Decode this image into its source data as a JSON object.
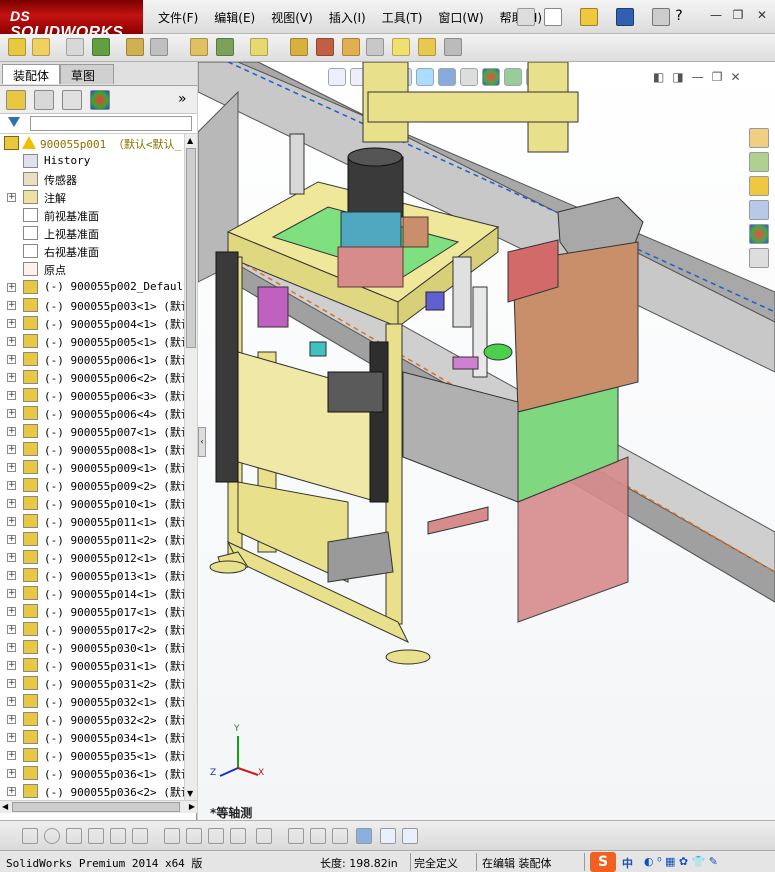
{
  "app": {
    "logo_prefix": "DS",
    "logo": "SOLIDWORKS"
  },
  "menu": [
    "文件(F)",
    "编辑(E)",
    "视图(V)",
    "插入(I)",
    "工具(T)",
    "窗口(W)",
    "帮助(H)"
  ],
  "window_buttons": {
    "minimize": "—",
    "restore": "❐",
    "close": "✕"
  },
  "panel_tabs": {
    "assembly": "装配体",
    "sketch": "草图"
  },
  "panel_collapse": "»",
  "tree": {
    "root": "900055p001 （默认<默认_",
    "items": [
      {
        "label": "History",
        "icon": "history-icon",
        "expandable": false
      },
      {
        "label": "传感器",
        "icon": "sensor-icon",
        "expandable": false
      },
      {
        "label": "注解",
        "icon": "annotation-icon",
        "expandable": true
      },
      {
        "label": "前视基准面",
        "icon": "plane-icon",
        "expandable": false
      },
      {
        "label": "上视基准面",
        "icon": "plane-icon",
        "expandable": false
      },
      {
        "label": "右视基准面",
        "icon": "plane-icon",
        "expandable": false
      },
      {
        "label": "原点",
        "icon": "origin-icon",
        "expandable": false
      },
      {
        "label": "(-) 900055p002_Default_",
        "icon": "part-icon",
        "expandable": true
      },
      {
        "label": "(-) 900055p003<1> (默认",
        "icon": "part-icon",
        "expandable": true
      },
      {
        "label": "(-) 900055p004<1> (默认",
        "icon": "part-icon",
        "expandable": true
      },
      {
        "label": "(-) 900055p005<1> (默认",
        "icon": "part-icon",
        "expandable": true
      },
      {
        "label": "(-) 900055p006<1> (默认",
        "icon": "part-icon",
        "expandable": true
      },
      {
        "label": "(-) 900055p006<2> (默认",
        "icon": "part-icon",
        "expandable": true
      },
      {
        "label": "(-) 900055p006<3> (默认",
        "icon": "part-icon",
        "expandable": true
      },
      {
        "label": "(-) 900055p006<4> (默认",
        "icon": "part-icon",
        "expandable": true
      },
      {
        "label": "(-) 900055p007<1> (默认",
        "icon": "part-icon",
        "expandable": true
      },
      {
        "label": "(-) 900055p008<1> (默认",
        "icon": "part-icon",
        "expandable": true
      },
      {
        "label": "(-) 900055p009<1> (默认",
        "icon": "part-icon",
        "expandable": true
      },
      {
        "label": "(-) 900055p009<2> (默认",
        "icon": "part-icon",
        "expandable": true
      },
      {
        "label": "(-) 900055p010<1> (默认",
        "icon": "part-icon",
        "expandable": true
      },
      {
        "label": "(-) 900055p011<1> (默认",
        "icon": "part-icon",
        "expandable": true
      },
      {
        "label": "(-) 900055p011<2> (默认",
        "icon": "part-icon",
        "expandable": true
      },
      {
        "label": "(-) 900055p012<1> (默认",
        "icon": "part-icon",
        "expandable": true
      },
      {
        "label": "(-) 900055p013<1> (默认",
        "icon": "part-icon",
        "expandable": true
      },
      {
        "label": "(-) 900055p014<1> (默认",
        "icon": "part-icon",
        "expandable": true
      },
      {
        "label": "(-) 900055p017<1> (默认",
        "icon": "part-icon",
        "expandable": true
      },
      {
        "label": "(-) 900055p017<2> (默认",
        "icon": "part-icon",
        "expandable": true
      },
      {
        "label": "(-) 900055p030<1> (默认",
        "icon": "part-icon",
        "expandable": true
      },
      {
        "label": "(-) 900055p031<1> (默认",
        "icon": "part-icon",
        "expandable": true
      },
      {
        "label": "(-) 900055p031<2> (默认",
        "icon": "part-icon",
        "expandable": true
      },
      {
        "label": "(-) 900055p032<1> (默认",
        "icon": "part-icon",
        "expandable": true
      },
      {
        "label": "(-) 900055p032<2> (默认",
        "icon": "part-icon",
        "expandable": true
      },
      {
        "label": "(-) 900055p034<1> (默认",
        "icon": "part-icon",
        "expandable": true
      },
      {
        "label": "(-) 900055p035<1> (默认",
        "icon": "part-icon",
        "expandable": true
      },
      {
        "label": "(-) 900055p036<1> (默认",
        "icon": "part-icon",
        "expandable": true
      },
      {
        "label": "(-) 900055p036<2> (默认",
        "icon": "part-icon",
        "expandable": true
      }
    ]
  },
  "viewport": {
    "view_label": "*等轴测",
    "triad": {
      "x": "X",
      "y": "Y",
      "z": "Z"
    }
  },
  "status": {
    "product": "SolidWorks Premium 2014 x64 版",
    "length": "长度: 198.82in",
    "defined": "完全定义",
    "editing": "在编辑 装配体",
    "ime": "中"
  },
  "colors": {
    "frame_yellow": "#e8e08a",
    "rail_grey": "#9a9a9a",
    "green_plate": "#7fe07f",
    "pink_plate": "#d78c8c",
    "brown_plate": "#c98f6a",
    "logo_red": "#b00e0e"
  }
}
